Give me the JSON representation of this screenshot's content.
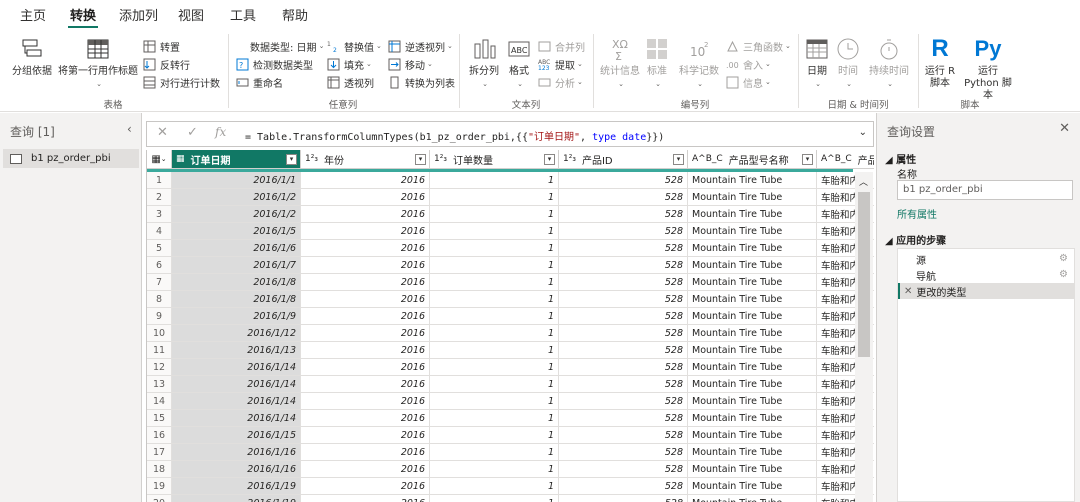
{
  "tabs": [
    "主页",
    "转换",
    "添加列",
    "视图",
    "工具",
    "帮助"
  ],
  "ribbon": {
    "group_table": {
      "label": "表格",
      "group_by": "分组依据",
      "first_row_header": "将第一行用作标题",
      "transpose": "转置",
      "reverse_rows": "反转行",
      "count_rows": "对行进行计数"
    },
    "group_any": {
      "label": "任意列",
      "data_type": "数据类型: 日期",
      "detect_type": "检测数据类型",
      "rename": "重命名",
      "replace_values": "替换值",
      "fill": "填充",
      "pivot": "透视列",
      "unpivot": "逆透视列",
      "move": "移动",
      "to_list": "转换为列表"
    },
    "group_text": {
      "label": "文本列",
      "split": "拆分列",
      "format": "格式",
      "merge": "合并列",
      "extract": "提取",
      "analyze": "分析"
    },
    "group_number": {
      "label": "编号列",
      "statistics": "统计信息",
      "standard": "标准",
      "scientific": "科学记数",
      "trig": "三角函数",
      "rounding": "舍入",
      "info": "信息"
    },
    "group_datetime": {
      "label": "日期 & 时间列",
      "date": "日期",
      "time": "时间",
      "duration": "持续时间"
    },
    "group_script": {
      "label": "脚本",
      "run_r": "运行 R 脚本",
      "run_py": "运行 Python 脚本"
    }
  },
  "queries": {
    "title": "查询 [1]",
    "items": [
      "b1 pz_order_pbi"
    ]
  },
  "formula": {
    "prefix": "= Table.TransformColumnTypes(b1_pz_order_pbi,{{",
    "str": "\"订单日期\"",
    "mid": ", ",
    "kw": "type date",
    "suffix": "}})"
  },
  "grid": {
    "columns": [
      {
        "type": "▦",
        "name": "订单日期"
      },
      {
        "type": "1²₃",
        "name": "年份"
      },
      {
        "type": "1²₃",
        "name": "订单数量"
      },
      {
        "type": "1²₃",
        "name": "产品ID"
      },
      {
        "type": "A^B_C",
        "name": "产品型号名称"
      },
      {
        "type": "A^B_C",
        "name": "产品名称"
      }
    ],
    "rows": [
      [
        "1",
        "2016/1/1",
        "2016",
        "1",
        "528",
        "Mountain Tire Tube",
        "车胎和内胎"
      ],
      [
        "2",
        "2016/1/2",
        "2016",
        "1",
        "528",
        "Mountain Tire Tube",
        "车胎和内胎"
      ],
      [
        "3",
        "2016/1/2",
        "2016",
        "1",
        "528",
        "Mountain Tire Tube",
        "车胎和内胎"
      ],
      [
        "4",
        "2016/1/5",
        "2016",
        "1",
        "528",
        "Mountain Tire Tube",
        "车胎和内胎"
      ],
      [
        "5",
        "2016/1/6",
        "2016",
        "1",
        "528",
        "Mountain Tire Tube",
        "车胎和内胎"
      ],
      [
        "6",
        "2016/1/7",
        "2016",
        "1",
        "528",
        "Mountain Tire Tube",
        "车胎和内胎"
      ],
      [
        "7",
        "2016/1/8",
        "2016",
        "1",
        "528",
        "Mountain Tire Tube",
        "车胎和内胎"
      ],
      [
        "8",
        "2016/1/8",
        "2016",
        "1",
        "528",
        "Mountain Tire Tube",
        "车胎和内胎"
      ],
      [
        "9",
        "2016/1/9",
        "2016",
        "1",
        "528",
        "Mountain Tire Tube",
        "车胎和内胎"
      ],
      [
        "10",
        "2016/1/12",
        "2016",
        "1",
        "528",
        "Mountain Tire Tube",
        "车胎和内胎"
      ],
      [
        "11",
        "2016/1/13",
        "2016",
        "1",
        "528",
        "Mountain Tire Tube",
        "车胎和内胎"
      ],
      [
        "12",
        "2016/1/14",
        "2016",
        "1",
        "528",
        "Mountain Tire Tube",
        "车胎和内胎"
      ],
      [
        "13",
        "2016/1/14",
        "2016",
        "1",
        "528",
        "Mountain Tire Tube",
        "车胎和内胎"
      ],
      [
        "14",
        "2016/1/14",
        "2016",
        "1",
        "528",
        "Mountain Tire Tube",
        "车胎和内胎"
      ],
      [
        "15",
        "2016/1/14",
        "2016",
        "1",
        "528",
        "Mountain Tire Tube",
        "车胎和内胎"
      ],
      [
        "16",
        "2016/1/15",
        "2016",
        "1",
        "528",
        "Mountain Tire Tube",
        "车胎和内胎"
      ],
      [
        "17",
        "2016/1/16",
        "2016",
        "1",
        "528",
        "Mountain Tire Tube",
        "车胎和内胎"
      ],
      [
        "18",
        "2016/1/16",
        "2016",
        "1",
        "528",
        "Mountain Tire Tube",
        "车胎和内胎"
      ],
      [
        "19",
        "2016/1/19",
        "2016",
        "1",
        "528",
        "Mountain Tire Tube",
        "车胎和内胎"
      ],
      [
        "20",
        "2016/1/19",
        "2016",
        "1",
        "528",
        "Mountain Tire Tube",
        "车胎和内胎"
      ]
    ]
  },
  "settings": {
    "title": "查询设置",
    "properties": "属性",
    "name_label": "名称",
    "name_value": "b1 pz_order_pbi",
    "all_props": "所有属性",
    "applied_steps": "应用的步骤",
    "steps": [
      "源",
      "导航",
      "更改的类型"
    ]
  },
  "colors": {
    "accent": "#117865",
    "teal_bar": "#3ba99c"
  }
}
